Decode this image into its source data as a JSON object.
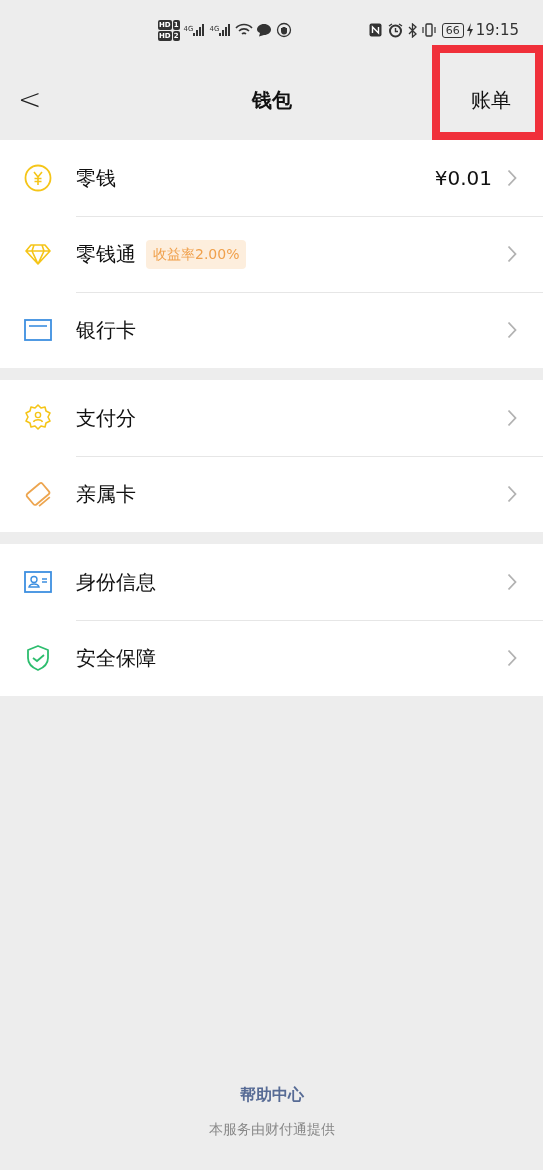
{
  "status_bar": {
    "sims": [
      {
        "badge": "HD",
        "slot": "1"
      },
      {
        "badge": "HD",
        "slot": "2"
      }
    ],
    "networks": [
      "4G",
      "4G"
    ],
    "battery": "66",
    "time": "19:15"
  },
  "nav": {
    "back": "<",
    "title": "钱包",
    "action": "账单",
    "action_highlighted": true
  },
  "sections": [
    {
      "rows": [
        {
          "kind": "coin",
          "label": "零钱",
          "value": "¥0.01"
        },
        {
          "kind": "diamond",
          "label": "零钱通",
          "tag": "收益率2.00%"
        },
        {
          "kind": "card",
          "label": "银行卡"
        }
      ]
    },
    {
      "rows": [
        {
          "kind": "badge",
          "label": "支付分"
        },
        {
          "kind": "family",
          "label": "亲属卡"
        }
      ]
    },
    {
      "rows": [
        {
          "kind": "id",
          "label": "身份信息"
        },
        {
          "kind": "shield",
          "label": "安全保障"
        }
      ]
    }
  ],
  "footer": {
    "link": "帮助中心",
    "note": "本服务由财付通提供"
  }
}
